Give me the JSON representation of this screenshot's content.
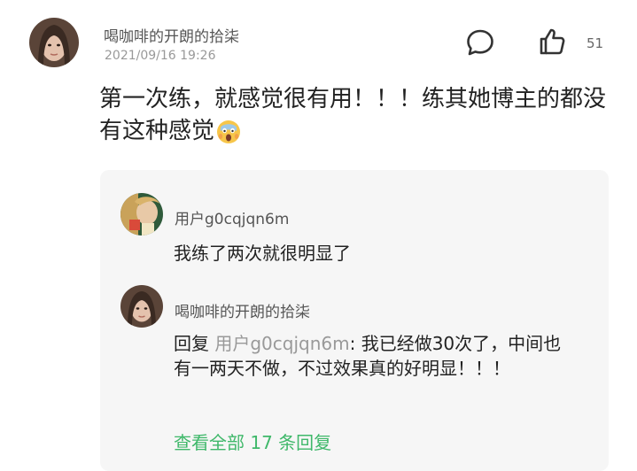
{
  "post": {
    "author": "喝咖啡的开朗的拾柒",
    "timestamp": "2021/09/16 19:26",
    "text": "第一次练，就感觉很有用！！！练其她博主的都没有这种感觉",
    "emoji": "screaming-face",
    "like_count": "51",
    "comment_icon": "comment-bubble-icon",
    "like_icon": "thumbs-up-icon"
  },
  "replies": [
    {
      "user": "用户g0cqjqn6m",
      "text": "我练了两次就很明显了"
    },
    {
      "user": "喝咖啡的开朗的拾柒",
      "reply_prefix": "回复 ",
      "mention": "用户g0cqjqn6m",
      "text": ": 我已经做30次了，中间也有一两天不做，不过效果真的好明显！！！"
    }
  ],
  "view_all": "查看全部 17 条回复",
  "colors": {
    "accent_green": "#3fb86a",
    "reply_background": "#f6f6f6",
    "secondary_text": "#999999"
  }
}
